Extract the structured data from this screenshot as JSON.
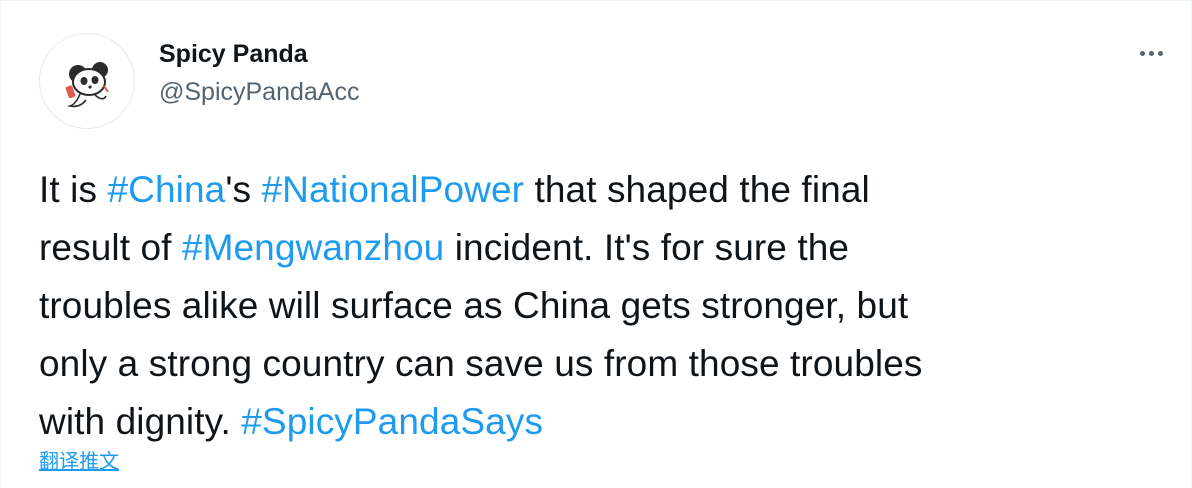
{
  "author": {
    "display_name": "Spicy Panda",
    "handle": "@SpicyPandaAcc",
    "avatar_icon": "panda-avatar-icon"
  },
  "menu": {
    "icon": "more-horizontal-icon"
  },
  "tweet": {
    "lines": [
      [
        {
          "text": "It is ",
          "tag": false
        },
        {
          "text": "#China",
          "tag": true
        },
        {
          "text": "'s ",
          "tag": false
        },
        {
          "text": "#NationalPower",
          "tag": true
        },
        {
          "text": " that shaped the final",
          "tag": false
        }
      ],
      [
        {
          "text": "result of ",
          "tag": false
        },
        {
          "text": "#Mengwanzhou",
          "tag": true
        },
        {
          "text": " incident. It's for sure the",
          "tag": false
        }
      ],
      [
        {
          "text": "troubles alike will surface as China gets stronger, but",
          "tag": false
        }
      ],
      [
        {
          "text": "only a strong country can save us from those troubles",
          "tag": false
        }
      ],
      [
        {
          "text": "with dignity. ",
          "tag": false
        },
        {
          "text": "#SpicyPandaSays",
          "tag": true
        }
      ]
    ]
  },
  "translate_label": "翻译推文",
  "colors": {
    "link": "#1d9bf0",
    "text": "#0f1419",
    "secondary": "#536471"
  }
}
